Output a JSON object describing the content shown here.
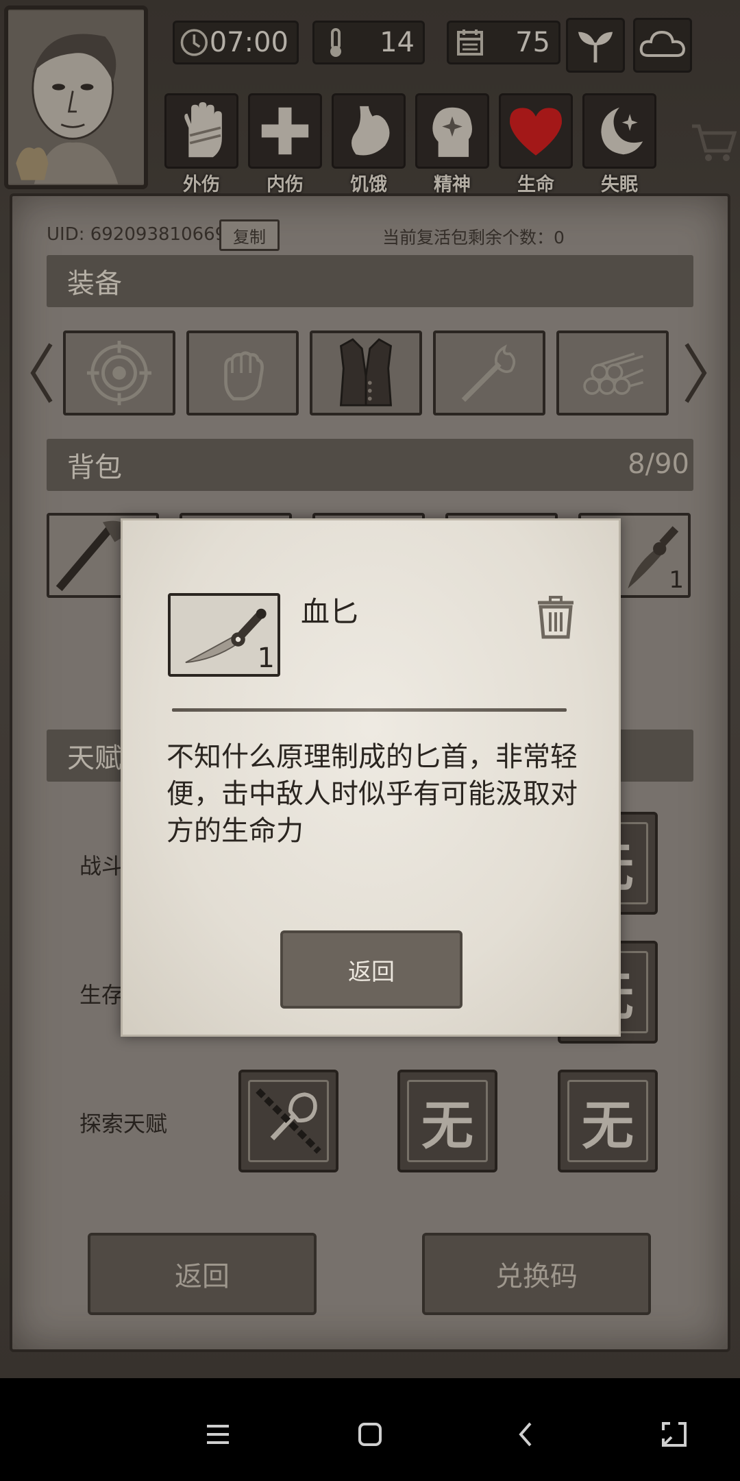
{
  "hud": {
    "time": "07:00",
    "temperature": "14",
    "day": "75",
    "status_labels": [
      "外伤",
      "内伤",
      "饥饿",
      "精神",
      "生命",
      "失眠"
    ]
  },
  "account": {
    "uid_label": "UID: 692093810669",
    "copy_label": "复制",
    "revive_text": "当前复活包剩余个数：0"
  },
  "equipment": {
    "title": "装备"
  },
  "backpack": {
    "title": "背包",
    "count": "8/90",
    "last_slot_qty": "1"
  },
  "talents": {
    "title": "天赋",
    "rows": [
      "战斗天赋",
      "生存天赋",
      "探索天赋"
    ],
    "combat_label_visible": "战斗",
    "survival_label_visible": "生存",
    "explore_label": "探索天赋",
    "none_glyph": "无"
  },
  "buttons": {
    "back": "返回",
    "redeem": "兑换码"
  },
  "modal": {
    "item_name": "血匕",
    "item_qty": "1",
    "description": "不知什么原理制成的匕首，非常轻便，击中敌人时似乎有可能汲取对方的生命力",
    "back_label": "返回"
  },
  "colors": {
    "life": "#c21a1a",
    "panel": "#8d8780",
    "paper": "#e6e1d8"
  }
}
